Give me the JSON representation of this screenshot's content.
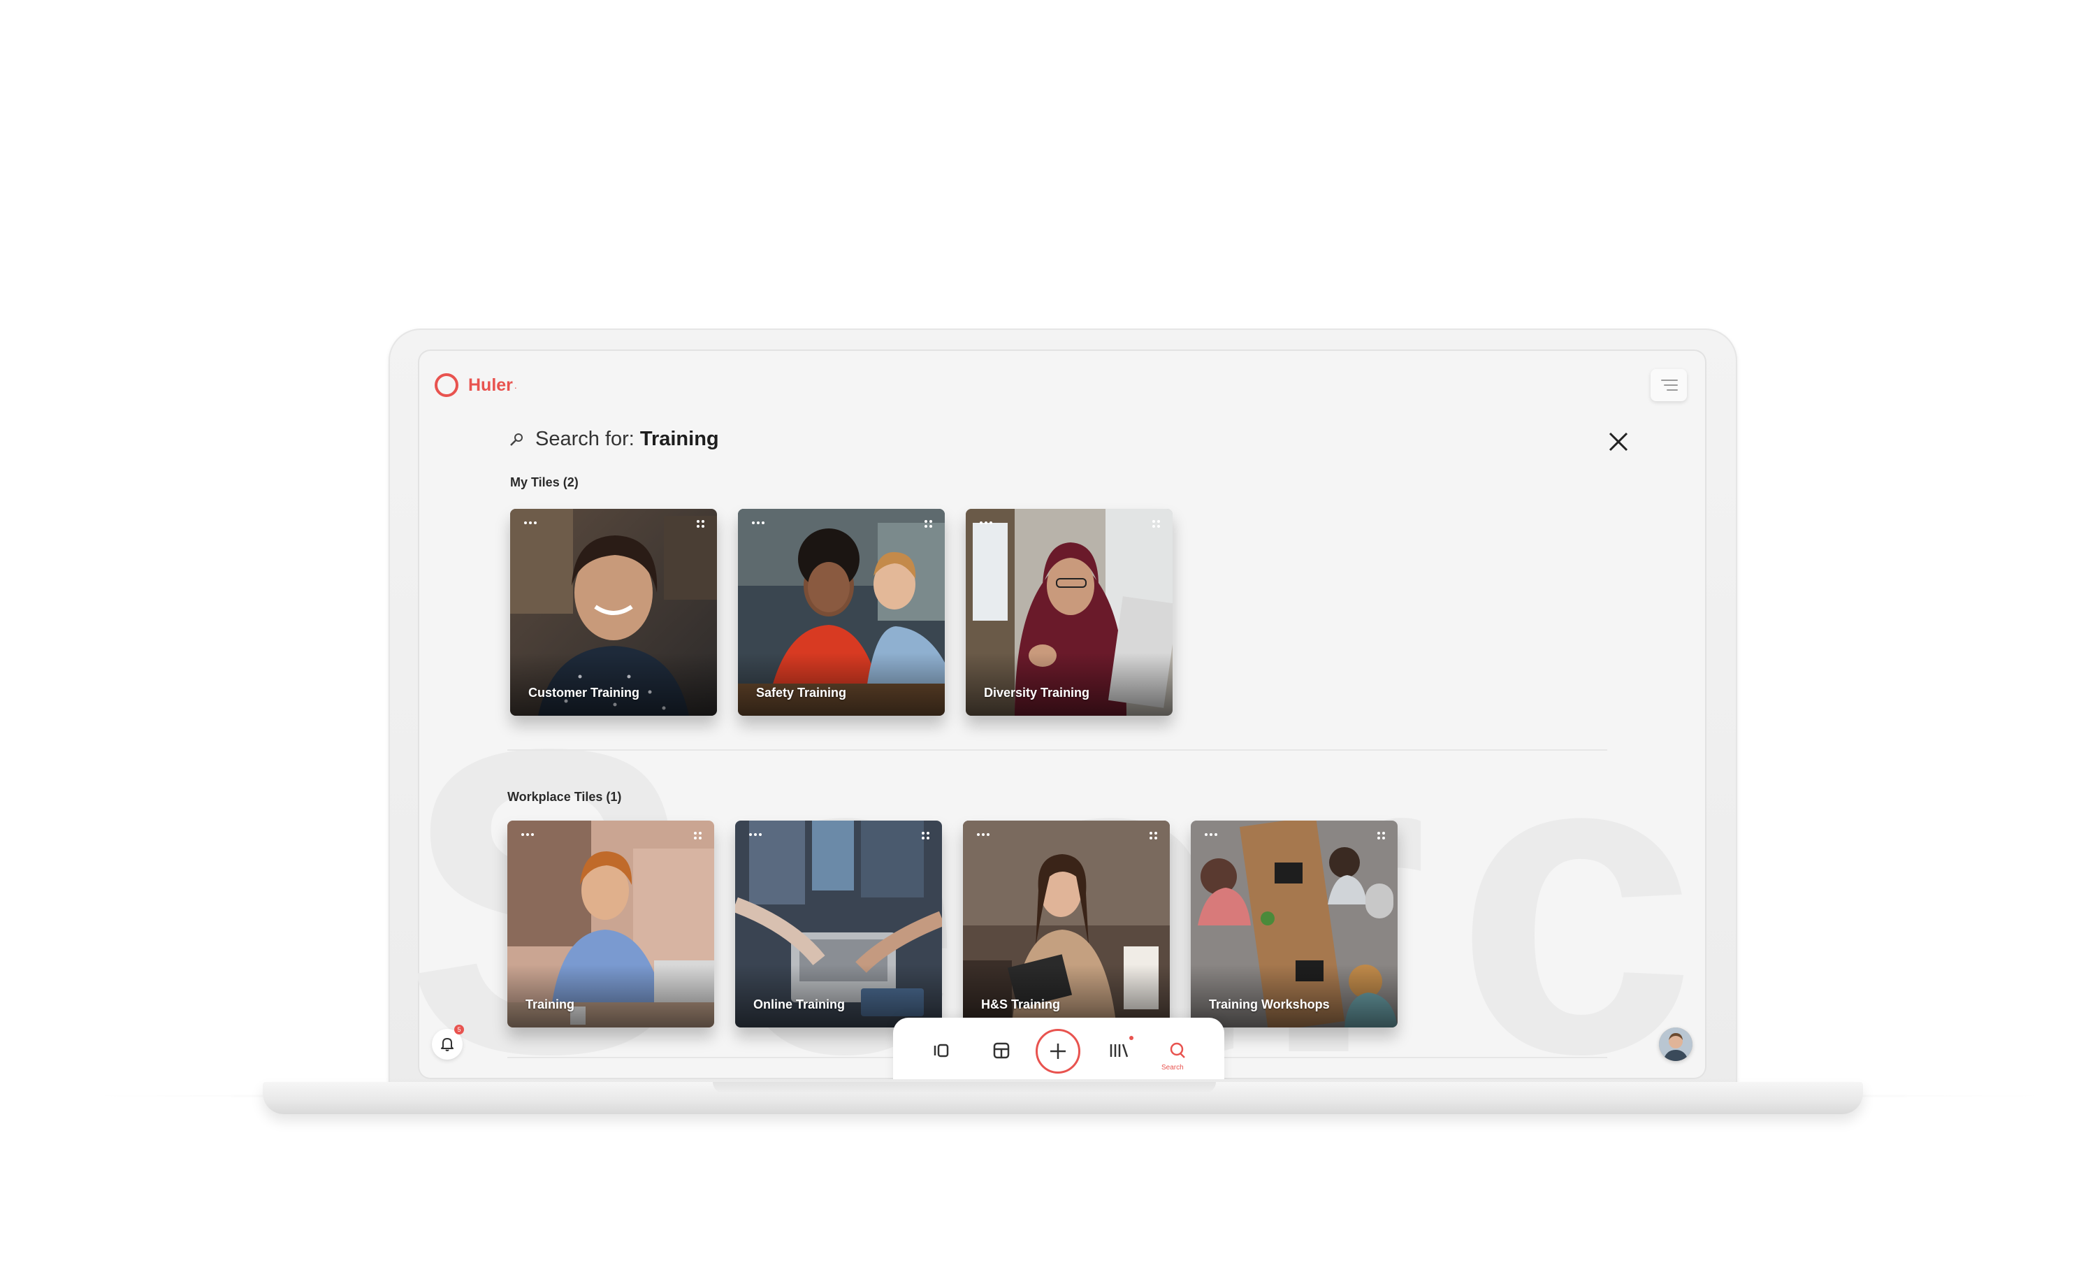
{
  "app": {
    "name": "Huler"
  },
  "search": {
    "prefix": "Search for:",
    "query": "Training"
  },
  "sections": {
    "my_tiles": {
      "label": "My Tiles (2)",
      "tiles": [
        {
          "title": "Customer Training"
        },
        {
          "title": "Safety Training"
        },
        {
          "title": "Diversity Training"
        }
      ]
    },
    "workplace_tiles": {
      "label": "Workplace Tiles (1)",
      "tiles": [
        {
          "title": "Training"
        },
        {
          "title": "Online Training"
        },
        {
          "title": "H&S Training"
        },
        {
          "title": "Training Workshops"
        }
      ]
    }
  },
  "background_word": "Search",
  "nav": {
    "search_label": "Search",
    "notification_count": "5"
  },
  "colors": {
    "accent": "#e8534f",
    "screen_bg": "#f5f5f5"
  }
}
